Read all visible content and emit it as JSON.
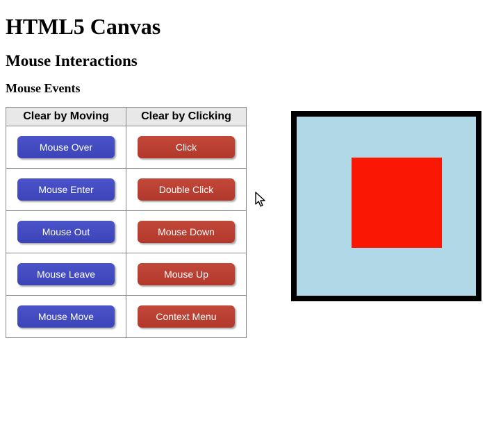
{
  "headings": {
    "h1": "HTML5 Canvas",
    "h2": "Mouse Interactions",
    "h3": "Mouse Events"
  },
  "table": {
    "headers": {
      "moving": "Clear by Moving",
      "clicking": "Clear by Clicking"
    },
    "rows": [
      {
        "moving": "Mouse Over",
        "clicking": "Click"
      },
      {
        "moving": "Mouse Enter",
        "clicking": "Double Click"
      },
      {
        "moving": "Mouse Out",
        "clicking": "Mouse Down"
      },
      {
        "moving": "Mouse Leave",
        "clicking": "Mouse Up"
      },
      {
        "moving": "Mouse Move",
        "clicking": "Context Menu"
      }
    ]
  },
  "colors": {
    "button_blue": "#3c44b8",
    "button_red": "#b1382b",
    "canvas_bg": "#b1d8e6",
    "canvas_square": "#fa1704",
    "canvas_border": "#000000"
  }
}
